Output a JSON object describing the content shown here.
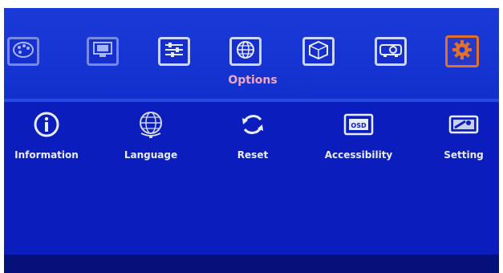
{
  "menu": {
    "section_title": "Options",
    "top_icons": [
      {
        "icon": "palette-icon"
      },
      {
        "icon": "monitor-icon"
      },
      {
        "icon": "equalizer-icon"
      },
      {
        "icon": "globe-icon"
      },
      {
        "icon": "3d-icon"
      },
      {
        "icon": "projector-icon"
      },
      {
        "icon": "gear-icon",
        "active": true
      }
    ],
    "options": [
      {
        "label": "Information",
        "icon": "info-icon"
      },
      {
        "label": "Language",
        "icon": "globe-icon"
      },
      {
        "label": "Reset",
        "icon": "reset-icon"
      },
      {
        "label": "Accessibility",
        "icon": "osd-icon"
      },
      {
        "label": "Setting",
        "icon": "setting-icon"
      }
    ]
  },
  "colors": {
    "background": "#0a1fb8",
    "active_border": "#e0702e",
    "title": "#f0a6c0"
  }
}
